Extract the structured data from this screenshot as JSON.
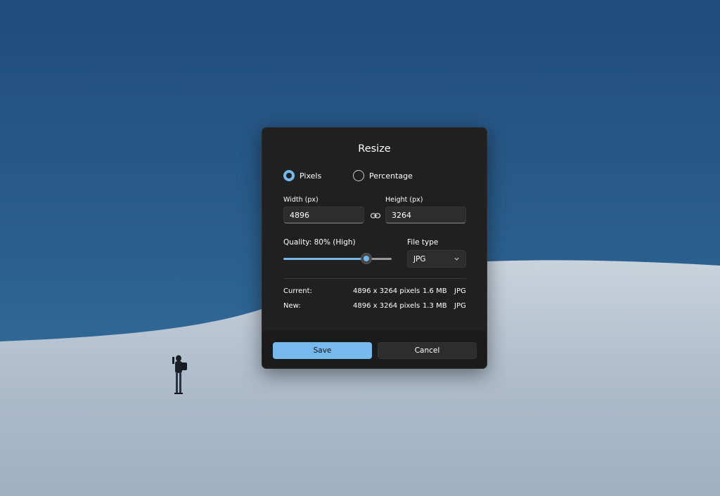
{
  "dialog": {
    "title": "Resize",
    "mode_options": [
      {
        "label": "Pixels",
        "selected": true
      },
      {
        "label": "Percentage",
        "selected": false
      }
    ],
    "width": {
      "label": "Width  (px)",
      "value": "4896"
    },
    "height": {
      "label": "Height  (px)",
      "value": "3264"
    },
    "link_icon": "link-icon",
    "quality": {
      "label": "Quality: 80% (High)",
      "value_percent": 80
    },
    "file_type": {
      "label": "File type",
      "selected": "JPG",
      "icon": "chevron-down-icon"
    },
    "current": {
      "label": "Current:",
      "dimensions": "4896 x 3264 pixels",
      "size": "1.6 MB",
      "type": "JPG"
    },
    "new": {
      "label": "New:",
      "dimensions": "4896 x 3264 pixels",
      "size": "1.3 MB",
      "type": "JPG"
    },
    "buttons": {
      "save": "Save",
      "cancel": "Cancel"
    }
  },
  "colors": {
    "accent": "#76b9ed",
    "dialog_bg": "#202020",
    "footer_bg": "#1b1b1b",
    "sky_top": "#2a5a86",
    "sand": "#b9c6d2"
  }
}
